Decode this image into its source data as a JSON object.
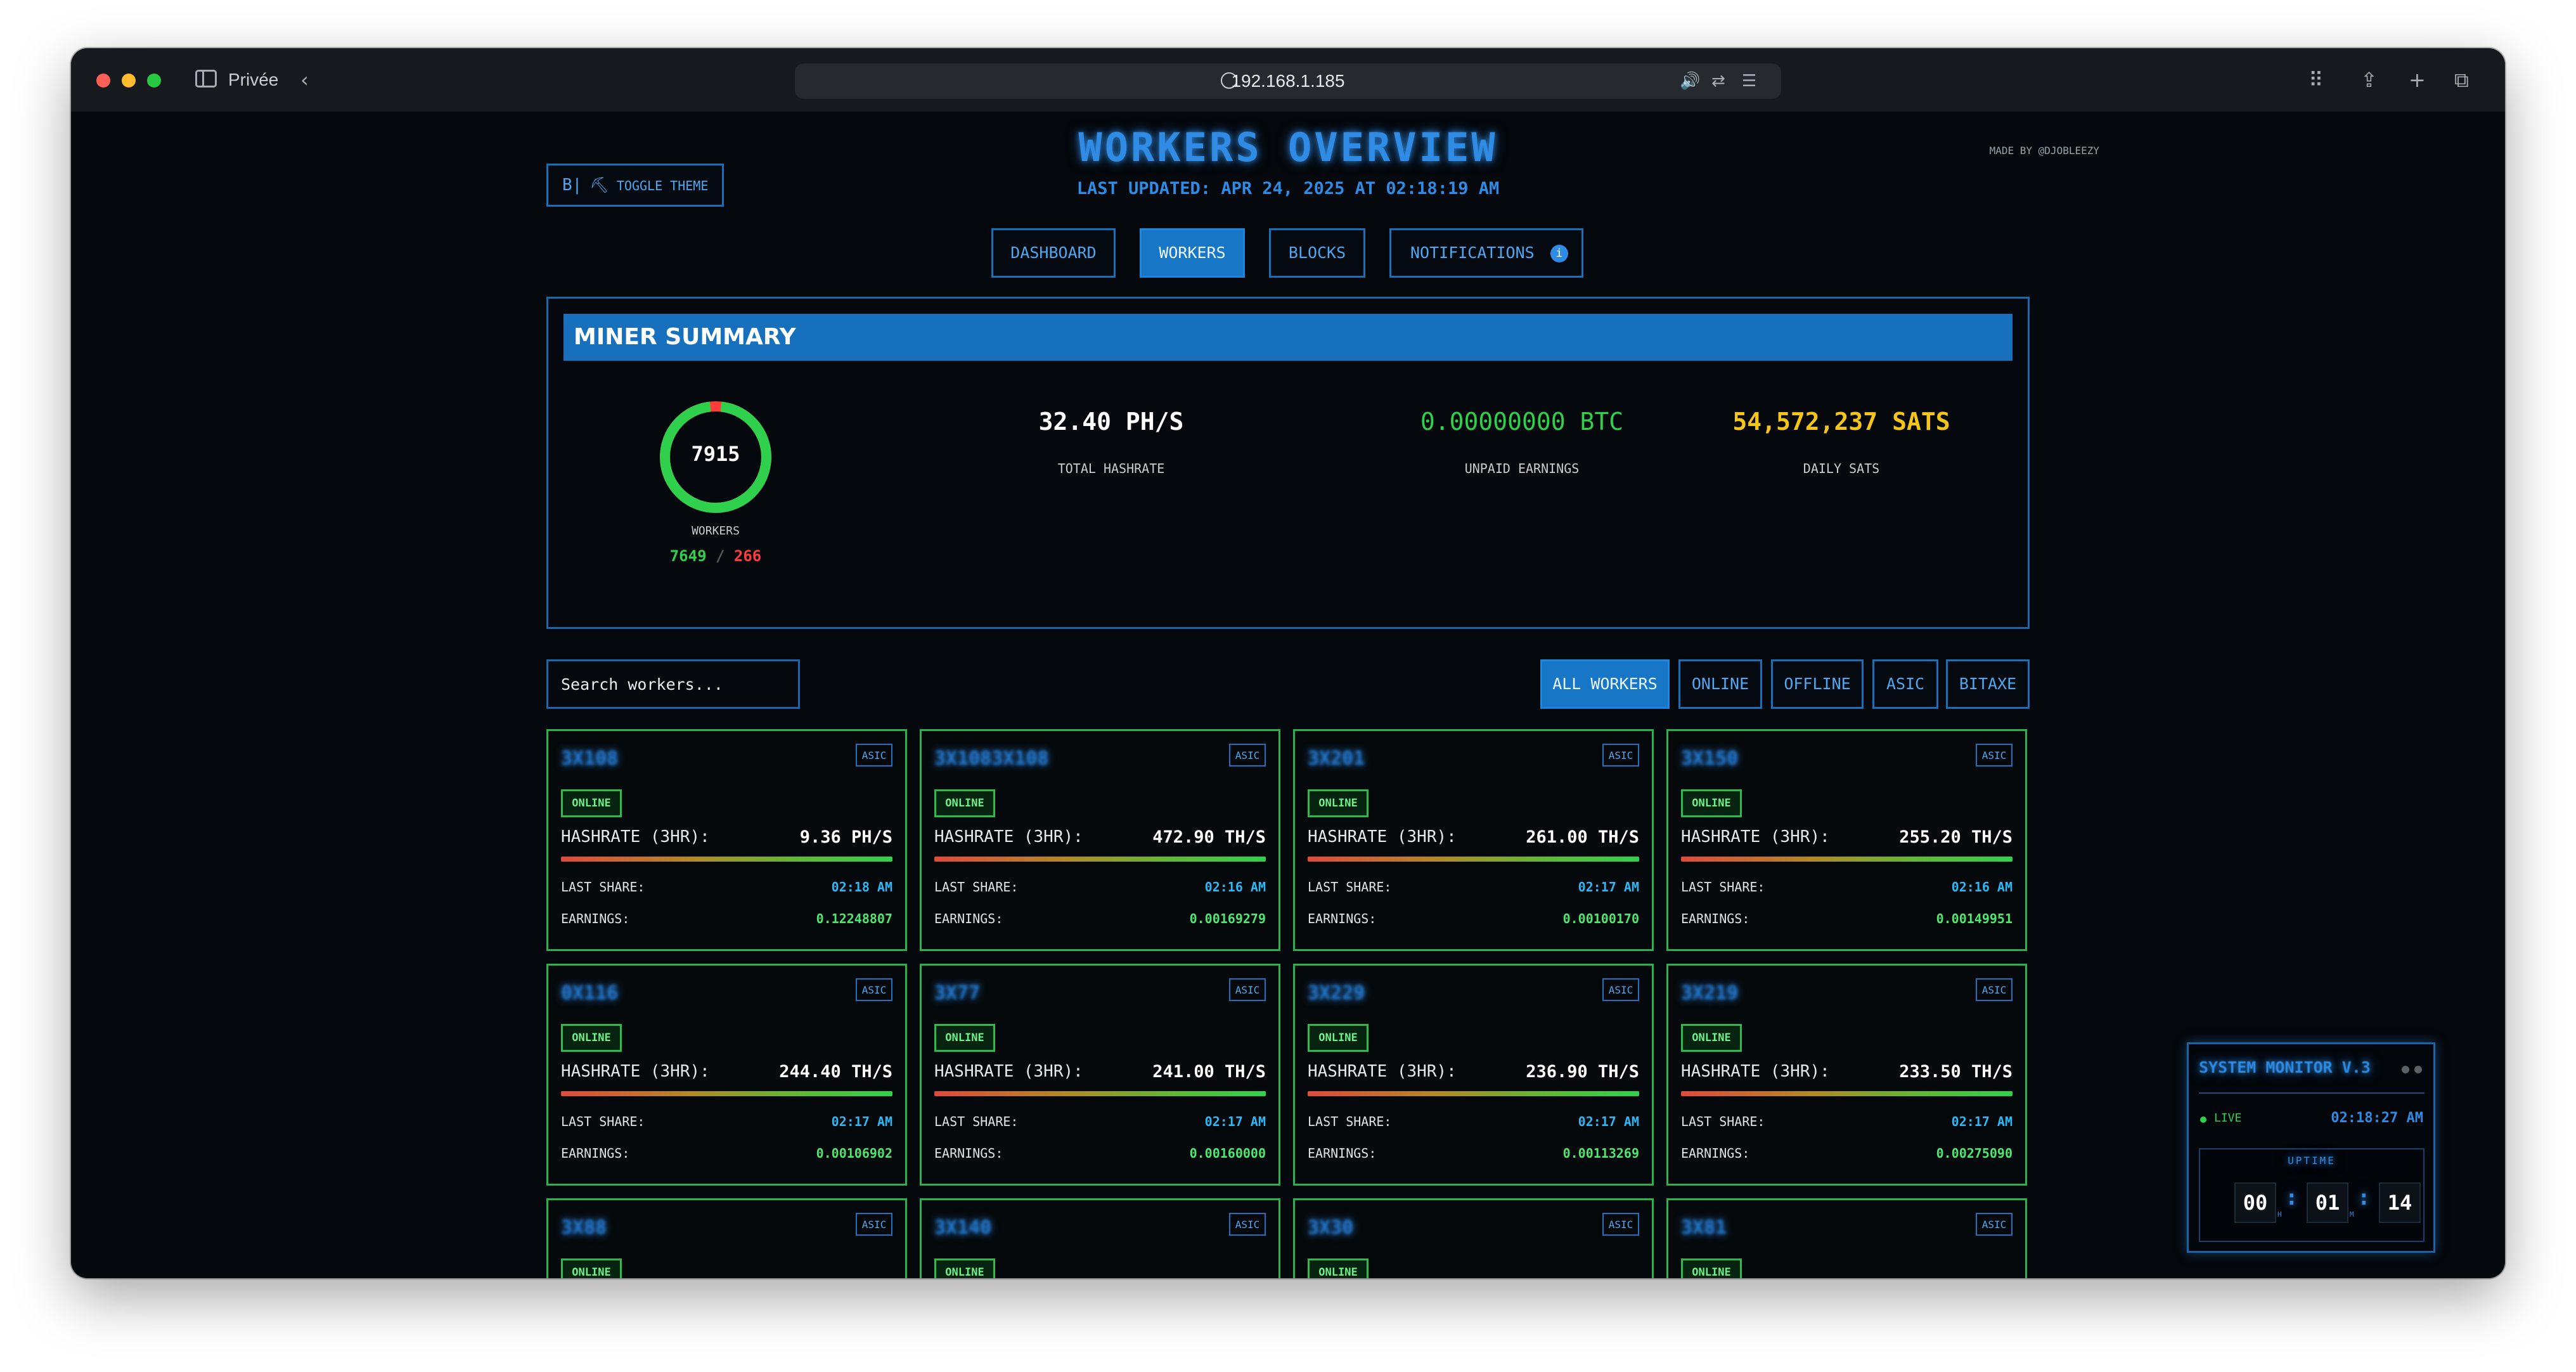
{
  "browser": {
    "private_label": "Privée",
    "url": "192.168.1.185"
  },
  "header": {
    "title": "WORKERS OVERVIEW",
    "last_updated": "LAST UPDATED: APR 24, 2025 AT 02:18:19 AM",
    "credit": "MADE BY @DJOBLEEZY",
    "theme_icon": "B|",
    "toggle_theme_label": "TOGGLE THEME"
  },
  "nav": {
    "tabs": [
      {
        "label": "DASHBOARD"
      },
      {
        "label": "WORKERS"
      },
      {
        "label": "BLOCKS"
      },
      {
        "label": "NOTIFICATIONS"
      }
    ],
    "notifications_badge": "i"
  },
  "summary": {
    "title": "MINER SUMMARY",
    "workers_total": "7915",
    "workers_label": "WORKERS",
    "workers_online": "7649",
    "workers_separator": "/",
    "workers_offline": "266",
    "online_fraction": 0.966,
    "total_hashrate": "32.40 PH/S",
    "total_hashrate_label": "TOTAL HASHRATE",
    "unpaid_earnings": "0.00000000 BTC",
    "unpaid_earnings_label": "UNPAID EARNINGS",
    "daily_sats": "54,572,237 SATS",
    "daily_sats_label": "DAILY SATS"
  },
  "filters": {
    "search_placeholder": "Search workers...",
    "buttons": [
      {
        "label": "ALL WORKERS"
      },
      {
        "label": "ONLINE"
      },
      {
        "label": "OFFLINE"
      },
      {
        "label": "ASIC"
      },
      {
        "label": "BITAXE"
      }
    ]
  },
  "card_labels": {
    "hashrate": "HASHRATE (3HR):",
    "last_share": "LAST SHARE:",
    "earnings": "EARNINGS:"
  },
  "workers": [
    {
      "name": "3X108",
      "type": "ASIC",
      "status": "ONLINE",
      "hashrate": "9.36 PH/S",
      "last_share": "02:18 AM",
      "earnings": "0.12248807"
    },
    {
      "name": "3X1083X108",
      "type": "ASIC",
      "status": "ONLINE",
      "hashrate": "472.90 TH/S",
      "last_share": "02:16 AM",
      "earnings": "0.00169279"
    },
    {
      "name": "3X201",
      "type": "ASIC",
      "status": "ONLINE",
      "hashrate": "261.00 TH/S",
      "last_share": "02:17 AM",
      "earnings": "0.00100170"
    },
    {
      "name": "3X150",
      "type": "ASIC",
      "status": "ONLINE",
      "hashrate": "255.20 TH/S",
      "last_share": "02:16 AM",
      "earnings": "0.00149951"
    },
    {
      "name": "0X116",
      "type": "ASIC",
      "status": "ONLINE",
      "hashrate": "244.40 TH/S",
      "last_share": "02:17 AM",
      "earnings": "0.00106902"
    },
    {
      "name": "3X77",
      "type": "ASIC",
      "status": "ONLINE",
      "hashrate": "241.00 TH/S",
      "last_share": "02:17 AM",
      "earnings": "0.00160000"
    },
    {
      "name": "3X229",
      "type": "ASIC",
      "status": "ONLINE",
      "hashrate": "236.90 TH/S",
      "last_share": "02:17 AM",
      "earnings": "0.00113269"
    },
    {
      "name": "3X219",
      "type": "ASIC",
      "status": "ONLINE",
      "hashrate": "233.50 TH/S",
      "last_share": "02:17 AM",
      "earnings": "0.00275090"
    },
    {
      "name": "3X88",
      "type": "ASIC",
      "status": "ONLINE"
    },
    {
      "name": "3X140",
      "type": "ASIC",
      "status": "ONLINE"
    },
    {
      "name": "3X30",
      "type": "ASIC",
      "status": "ONLINE"
    },
    {
      "name": "3X81",
      "type": "ASIC",
      "status": "ONLINE"
    }
  ],
  "monitor": {
    "title": "SYSTEM MONITOR V.3",
    "live_label": "LIVE",
    "time": "02:18:27 AM",
    "uptime_label": "UPTIME",
    "hours": "00",
    "hours_unit": "H",
    "minutes": "01",
    "minutes_unit": "M",
    "seconds": "14",
    "seconds_unit": "S"
  },
  "colors": {
    "accent_blue": "#1776c6",
    "online_green": "#2fd14c",
    "offline_red": "#ff3b3b",
    "sats_yellow": "#f5c518"
  }
}
